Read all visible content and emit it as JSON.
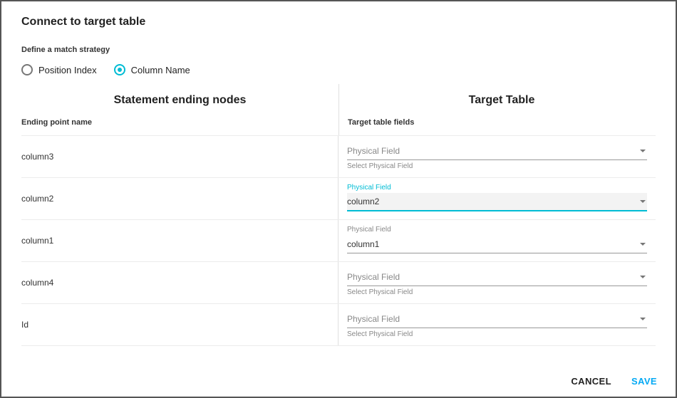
{
  "title": "Connect to target table",
  "strategy": {
    "label": "Define a match strategy",
    "options": [
      "Position Index",
      "Column Name"
    ],
    "selected": "Column Name"
  },
  "left": {
    "header": "Statement ending nodes",
    "subheader": "Ending point name"
  },
  "right": {
    "header": "Target Table",
    "subheader": "Target table fields"
  },
  "fieldLabel": "Physical Field",
  "helper": "Select Physical Field",
  "rows": [
    {
      "name": "column3",
      "value": null,
      "focused": false
    },
    {
      "name": "column2",
      "value": "column2",
      "focused": true
    },
    {
      "name": "column1",
      "value": "column1",
      "focused": false
    },
    {
      "name": "column4",
      "value": null,
      "focused": false
    },
    {
      "name": "Id",
      "value": null,
      "focused": false
    }
  ],
  "buttons": {
    "cancel": "CANCEL",
    "save": "SAVE"
  },
  "colors": {
    "accent": "#00bcd4",
    "saveLink": "#03a9f4"
  }
}
